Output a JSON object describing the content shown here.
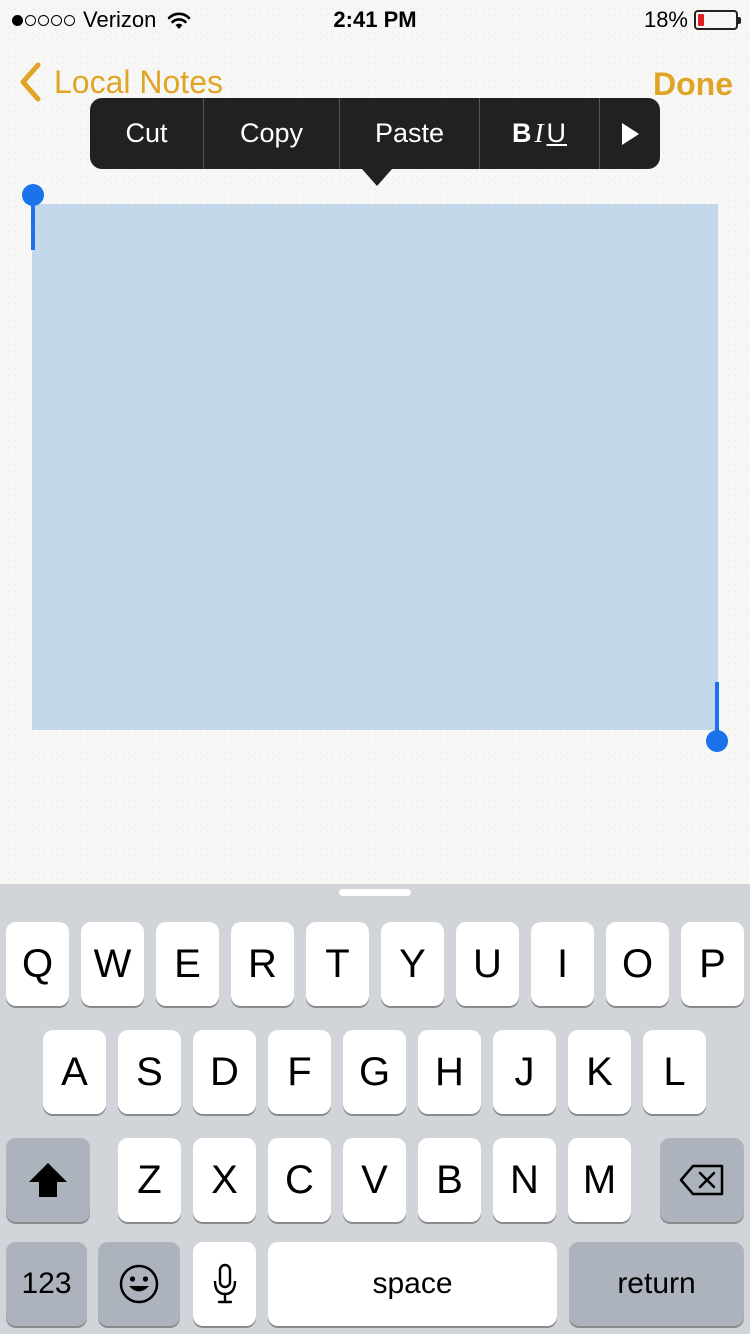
{
  "status_bar": {
    "signal_dots_filled": 1,
    "signal_dots_total": 5,
    "carrier": "Verizon",
    "wifi_icon": "wifi-icon",
    "time": "2:41 PM",
    "battery_percent": "18%",
    "battery_level": 0.18,
    "battery_color": "#e0201f"
  },
  "nav": {
    "back_icon": "chevron-left-icon",
    "back_label": "Local Notes",
    "done_label": "Done",
    "accent_color": "#e0a526"
  },
  "edit_menu": {
    "cut": "Cut",
    "copy": "Copy",
    "paste": "Paste",
    "format_bold": "B",
    "format_italic": "I",
    "format_underline": "U",
    "more_icon": "triangle-right-icon"
  },
  "selection": {
    "color": "#aac8e4",
    "handle_color": "#1a73e8"
  },
  "keyboard": {
    "row1": [
      "Q",
      "W",
      "E",
      "R",
      "T",
      "Y",
      "U",
      "I",
      "O",
      "P"
    ],
    "row2": [
      "A",
      "S",
      "D",
      "F",
      "G",
      "H",
      "J",
      "K",
      "L"
    ],
    "row3": [
      "Z",
      "X",
      "C",
      "V",
      "B",
      "N",
      "M"
    ],
    "shift_icon": "shift-arrow-icon",
    "backspace_icon": "backspace-icon",
    "numbers_label": "123",
    "emoji_icon": "emoji-smiley-icon",
    "mic_icon": "microphone-icon",
    "space_label": "space",
    "return_label": "return"
  }
}
